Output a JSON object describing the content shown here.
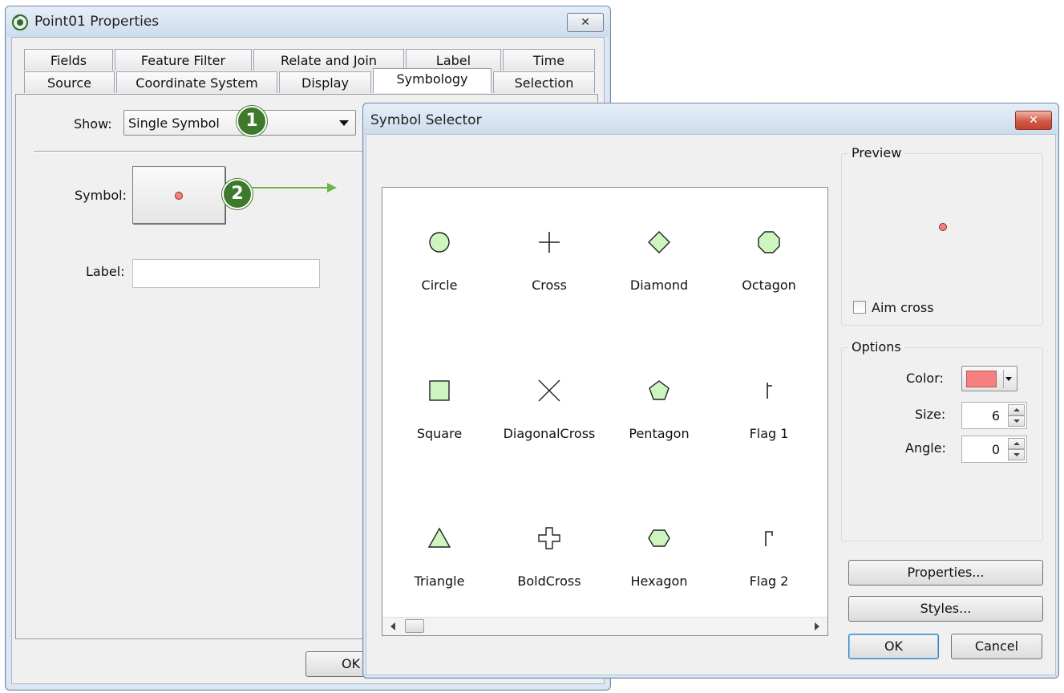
{
  "props_window": {
    "title": "Point01  Properties",
    "tabs_top": [
      "Fields",
      "Feature Filter",
      "Relate and Join",
      "Label",
      "Time"
    ],
    "tabs_bottom": [
      "Source",
      "Coordinate System",
      "Display",
      "Symbology",
      "Selection"
    ],
    "active_tab": "Symbology",
    "show_label": "Show:",
    "show_value": "Single Symbol",
    "symbol_label": "Symbol:",
    "label_label": "Label:",
    "label_value": "",
    "ok_label": "OK"
  },
  "callouts": [
    "1",
    "2"
  ],
  "selector": {
    "title": "Symbol Selector",
    "symbols": [
      {
        "name": "Circle",
        "icon": "circle-icon"
      },
      {
        "name": "Cross",
        "icon": "cross-icon"
      },
      {
        "name": "Diamond",
        "icon": "diamond-icon"
      },
      {
        "name": "Octagon",
        "icon": "octagon-icon"
      },
      {
        "name": "Square",
        "icon": "square-icon"
      },
      {
        "name": "DiagonalCross",
        "icon": "diagonal-cross-icon"
      },
      {
        "name": "Pentagon",
        "icon": "pentagon-icon"
      },
      {
        "name": "Flag 1",
        "icon": "flag1-icon"
      },
      {
        "name": "Triangle",
        "icon": "triangle-icon"
      },
      {
        "name": "BoldCross",
        "icon": "bold-cross-icon"
      },
      {
        "name": "Hexagon",
        "icon": "hexagon-icon"
      },
      {
        "name": "Flag 2",
        "icon": "flag2-icon"
      }
    ],
    "preview_title": "Preview",
    "aim_cross_label": "Aim cross",
    "aim_cross_checked": false,
    "options_title": "Options",
    "color_label": "Color:",
    "color_value": "#f58080",
    "size_label": "Size:",
    "size_value": "6",
    "angle_label": "Angle:",
    "angle_value": "0",
    "properties_button": "Properties...",
    "styles_button": "Styles...",
    "ok_button": "OK",
    "cancel_button": "Cancel"
  },
  "colors": {
    "symbol_fill": "#ccf5c0",
    "marker_red": "#f58080",
    "callout_green": "#3f7a2c",
    "arrow_green": "#6eb34a"
  }
}
